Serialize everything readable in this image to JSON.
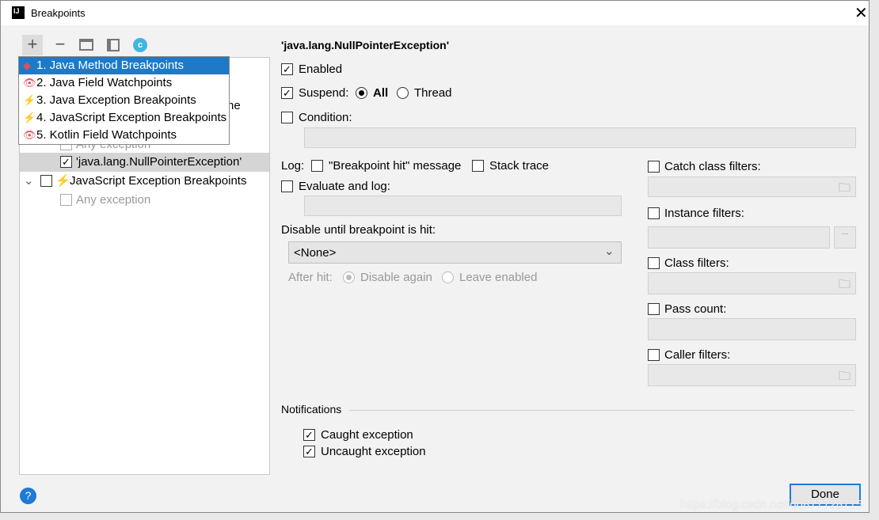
{
  "title": "Breakpoints",
  "toolbar": {
    "add": "+",
    "remove": "−"
  },
  "popup": [
    {
      "label": "1. Java Method Breakpoints",
      "icon": "diamond-icon"
    },
    {
      "label": "2. Java Field Watchpoints",
      "icon": "eye-icon"
    },
    {
      "label": "3. Java Exception Breakpoints",
      "icon": "lightning-icon"
    },
    {
      "label": "4. JavaScript Exception Breakpoints",
      "icon": "lightning-icon"
    },
    {
      "label": "5. Kotlin Field Watchpoints",
      "icon": "eye-icon"
    }
  ],
  "tree": {
    "partial": "ne",
    "any1": "Any exception",
    "npe": "'java.lang.NullPointerException'",
    "js": "JavaScript Exception Breakpoints",
    "any2": "Any exception"
  },
  "detail": {
    "heading": "'java.lang.NullPointerException'",
    "enabled": "Enabled",
    "suspend": "Suspend:",
    "all": "All",
    "thread": "Thread",
    "condition": "Condition:",
    "log": "Log:",
    "bp_msg": "\"Breakpoint hit\" message",
    "stack": "Stack trace",
    "evaluate": "Evaluate and log:",
    "disable_until": "Disable until breakpoint is hit:",
    "none": "<None>",
    "after_hit": "After hit:",
    "disable_again": "Disable again",
    "leave_enabled": "Leave enabled",
    "catch": "Catch class filters:",
    "instance": "Instance filters:",
    "class": "Class filters:",
    "pass": "Pass count:",
    "caller": "Caller filters:",
    "notifications": "Notifications",
    "caught": "Caught exception",
    "uncaught": "Uncaught exception"
  },
  "done": "Done",
  "watermark": "https://blog.csdn.net/qq877728715"
}
